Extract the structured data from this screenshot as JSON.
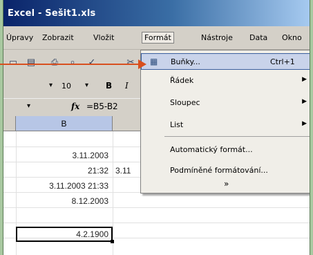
{
  "window": {
    "title": "Excel - Sešit1.xls"
  },
  "menu": [
    "Úpravy",
    "Zobrazit",
    "Vložit",
    "Formát",
    "Nástroje",
    "Data",
    "Okno"
  ],
  "format_menu": {
    "items": [
      {
        "label": "Buňky...",
        "shortcut": "Ctrl+1",
        "has_submenu": false,
        "icon": "cells-icon"
      },
      {
        "label": "Řádek",
        "shortcut": "",
        "has_submenu": true
      },
      {
        "label": "Sloupec",
        "shortcut": "",
        "has_submenu": true
      },
      {
        "label": "List",
        "shortcut": "",
        "has_submenu": true
      },
      {
        "label": "Automatický formát...",
        "shortcut": "",
        "has_submenu": false
      },
      {
        "label": "Podmíněné formátování...",
        "shortcut": "",
        "has_submenu": false
      }
    ],
    "more": "»"
  },
  "formatting": {
    "font_size": "10",
    "bold": "B",
    "italic": "I"
  },
  "formula_bar": {
    "fx": "fx",
    "formula": "=B5-B2"
  },
  "columns": [
    "B"
  ],
  "cells": [
    "3.11.2003",
    "21:32",
    "3.11",
    "3.11.2003 21:33",
    "8.12.2003",
    "4.2.1900"
  ]
}
